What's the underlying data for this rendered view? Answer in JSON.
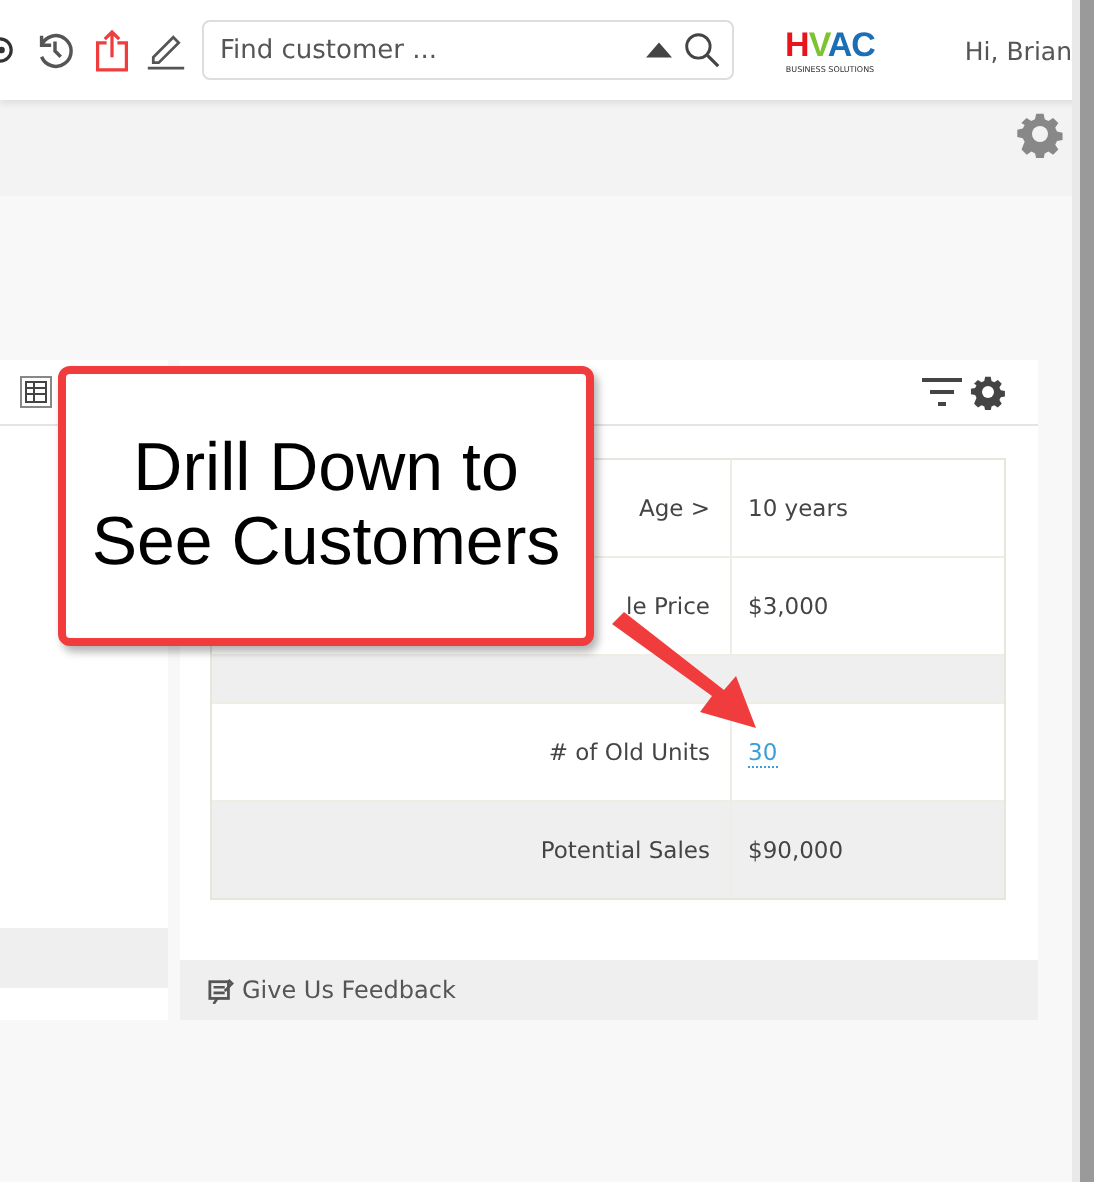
{
  "toolbar": {
    "search": {
      "placeholder": "Find customer ..."
    },
    "logo": {
      "parts": [
        {
          "text": "H",
          "color": "#e8141c"
        },
        {
          "text": "V",
          "color": "#7cc431"
        },
        {
          "text": "AC",
          "color": "#1a6fb5"
        }
      ],
      "tagline": "BUSINESS SOLUTIONS"
    },
    "greeting": "Hi, Brian"
  },
  "table": {
    "rows": [
      {
        "kind": "data",
        "label": "Age >",
        "value": "10 years",
        "link": false,
        "shaded": false
      },
      {
        "kind": "data",
        "label": "le Price",
        "value": "$3,000",
        "link": false,
        "shaded": false
      },
      {
        "kind": "spacer",
        "shaded": true
      },
      {
        "kind": "data",
        "label": "# of Old Units",
        "value": "30",
        "link": true,
        "shaded": false
      },
      {
        "kind": "data",
        "label": "Potential Sales",
        "value": "$90,000",
        "link": false,
        "shaded": true
      }
    ]
  },
  "footer": {
    "feedback": "Give Us Feedback"
  },
  "callout": {
    "text": "Drill Down to See Customers"
  }
}
